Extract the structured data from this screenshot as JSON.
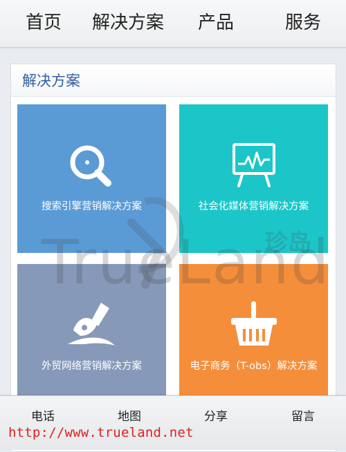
{
  "top_nav": {
    "items": [
      {
        "label": "首页"
      },
      {
        "label": "解决方案"
      },
      {
        "label": "产品"
      },
      {
        "label": "服务"
      }
    ]
  },
  "panel": {
    "title": "解决方案"
  },
  "tiles": [
    {
      "label": "搜索引擎营销解决方案",
      "color": "#5b9bd5",
      "icon": "search-icon"
    },
    {
      "label": "社会化媒体营销解决方案",
      "color": "#1cc6c8",
      "icon": "presentation-chart-icon"
    },
    {
      "label": "外贸网络营销解决方案",
      "color": "#8699b9",
      "icon": "ship-icon"
    },
    {
      "label": "电子商务（T-obs）解决方案",
      "color": "#f58e3b",
      "icon": "basket-icon"
    }
  ],
  "watermark": {
    "text": "TrueLand",
    "cn": "珍岛"
  },
  "bottom_bar": {
    "items": [
      {
        "label": "电话"
      },
      {
        "label": "地图"
      },
      {
        "label": "分享"
      },
      {
        "label": "留言"
      }
    ]
  },
  "url_overlay": "http://www.trueland.net"
}
